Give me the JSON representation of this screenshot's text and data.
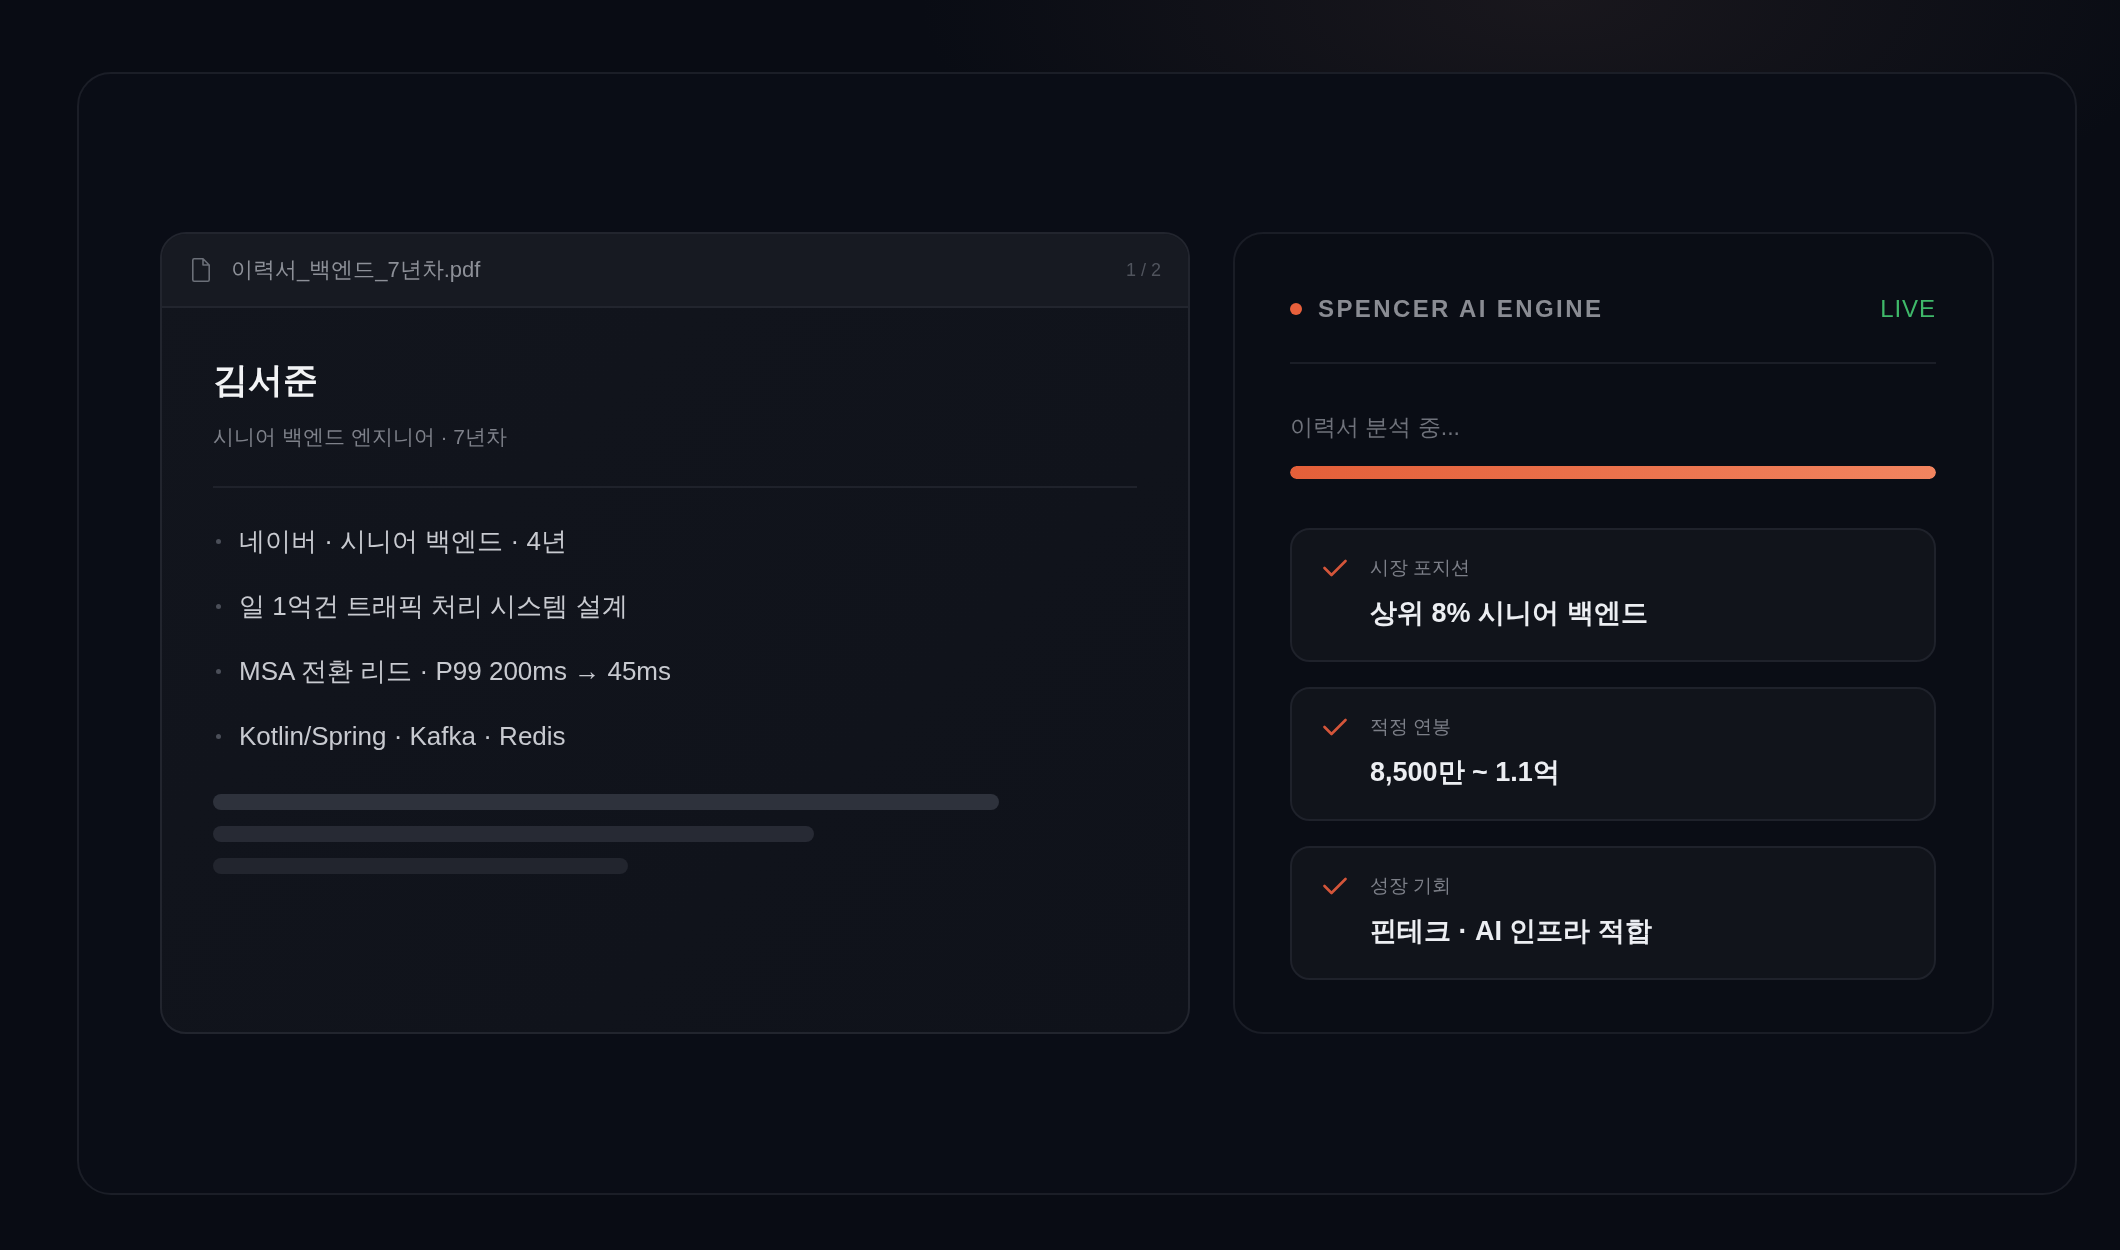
{
  "document": {
    "file_name": "이력서_백엔드_7년차.pdf",
    "page": "1 / 2",
    "name": "김서준",
    "subtitle": "시니어 백엔드 엔지니어 · 7년차",
    "highlights": [
      "네이버 · 시니어 백엔드 · 4년",
      "일 1억건 트래픽 처리 시스템 설계",
      "MSA 전환 리드 · P99 200ms → 45ms",
      "Kotlin/Spring · Kafka · Redis"
    ]
  },
  "engine": {
    "title": "SPENCER AI ENGINE",
    "status": "LIVE",
    "task": "이력서 분석 중...",
    "progress": {
      "level": 1
    },
    "results": [
      {
        "label": "시장 포지션",
        "value": "상위 8% 시니어 백엔드",
        "done": true
      },
      {
        "label": "적정 연봉",
        "value": "8,500만 ~ 1.1억",
        "done": true
      },
      {
        "label": "성장 기회",
        "value": "핀테크 · AI 인프라 적합",
        "done": true
      }
    ]
  }
}
